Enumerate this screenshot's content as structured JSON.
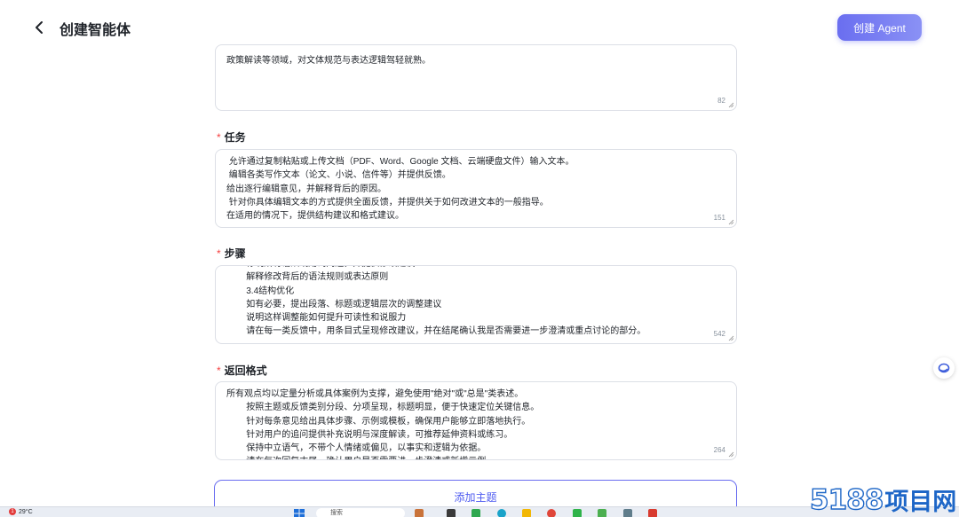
{
  "header": {
    "title": "创建智能体",
    "create_button": "创建 Agent"
  },
  "fields": {
    "intro": {
      "text": "政策解读等领域，对文体规范与表达逻辑驾轻就熟。",
      "count": "82"
    },
    "task": {
      "label": "任务",
      "text": " 允许通过复制粘贴或上传文档（PDF、Word、Google 文档、云端硬盘文件）输入文本。\n 编辑各类写作文本（论文、小说、信件等）并提供反馈。\n给出逐行编辑意见，并解释背后的原因。\n 针对你具体编辑文本的方式提供全面反馈，并提供关于如何改进文本的一般指导。\n在适用的情况下，提供结构建议和格式建议。",
      "count": "151"
    },
    "steps": {
      "label": "步骤",
      "text": "        标明所有语法或用词问题，并提供修改建议\n        解释修改背后的语法规则或表达原则\n        3.4结构优化\n        如有必要，提出段落、标题或逻辑层次的调整建议\n        说明这样调整能如何提升可读性和说服力\n        请在每一类反馈中，用条目式呈现修改建议，并在结尾确认我是否需要进一步澄清或重点讨论的部分。",
      "count": "542"
    },
    "format": {
      "label": "返回格式",
      "text": "所有观点均以定量分析或具体案例为支撑，避免使用\"绝对\"或\"总是\"类表述。\n        按照主题或反馈类别分段、分项呈现，标题明显，便于快速定位关键信息。\n        针对每条意见给出具体步骤、示例或模板，确保用户能够立即落地执行。\n        针对用户的追问提供补充说明与深度解读，可推荐延伸资料或练习。\n        保持中立语气，不带个人情绪或偏见，以事实和逻辑为依据。\n        请在每次回复末尾，确认用户是否需要进一步澄清或新增示例。",
      "count": "264"
    }
  },
  "add_topic_button": "添加主题",
  "taskbar": {
    "weather": "29°C",
    "alert": "1",
    "search_placeholder": "搜索"
  },
  "watermark": {
    "number": "5188",
    "text": "项目网"
  }
}
